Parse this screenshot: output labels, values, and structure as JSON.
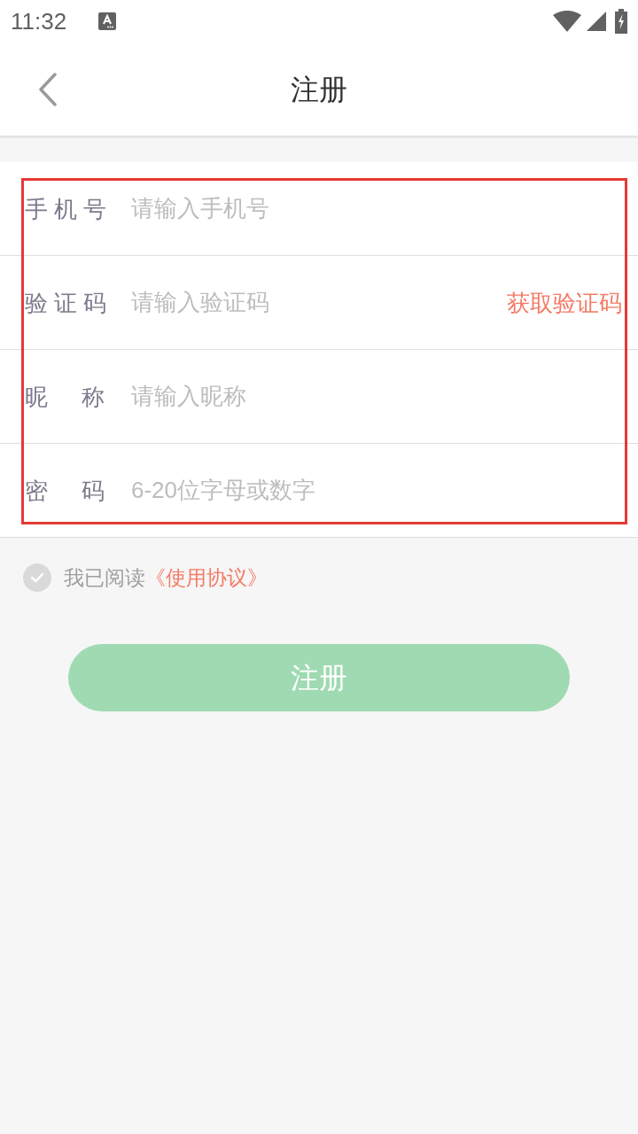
{
  "status_bar": {
    "time": "11:32"
  },
  "header": {
    "title": "注册"
  },
  "form": {
    "highlighted": true,
    "rows": [
      {
        "label": "手 机 号",
        "placeholder": "请输入手机号"
      },
      {
        "label": "验 证 码",
        "placeholder": "请输入验证码",
        "action": "获取验证码"
      },
      {
        "label": "昵 称",
        "placeholder": "请输入昵称"
      },
      {
        "label": "密 码",
        "placeholder": "6-20位字母或数字"
      }
    ]
  },
  "agreement": {
    "checked": false,
    "text": "我已阅读",
    "link": "《使用协议》"
  },
  "submit": {
    "label": "注册",
    "disabled": true
  }
}
